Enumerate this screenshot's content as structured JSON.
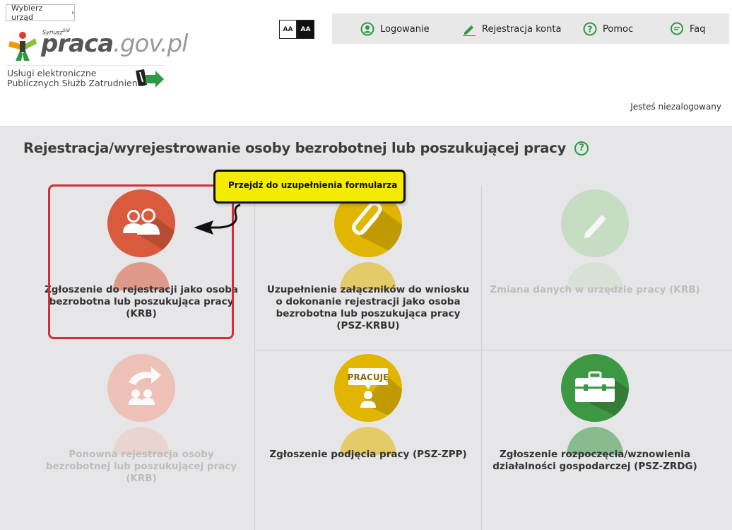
{
  "header": {
    "office_button": "Wybierz urząd",
    "logo": {
      "syriusz": "Syriusz",
      "syriusz_sup": "Std",
      "brand_main": "praca",
      "brand_suffix": ".gov.pl"
    },
    "services_line1": "Usługi elektroniczne",
    "services_line2": "Publicznych Służb Zatrudnienia",
    "font_size_small": "AA",
    "font_size_contrast": "AA",
    "nav": [
      {
        "label": "Logowanie",
        "icon": "user-circle-icon"
      },
      {
        "label": "Rejestracja konta",
        "icon": "pencil-icon"
      },
      {
        "label": "Pomoc",
        "icon": "question-circle-icon"
      },
      {
        "label": "Faq",
        "icon": "speech-bubble-icon"
      }
    ],
    "login_status": "Jesteś niezalogowany"
  },
  "main": {
    "title": "Rejestracja/wyrejestrowanie osoby bezrobotnej lub poszukującej pracy",
    "help_symbol": "?",
    "tooltip": "Przejdź do uzupełnienia formularza",
    "tiles": [
      {
        "label": "Zgłoszenie do rejestracji jako osoba bezrobotna lub poszukująca pracy (KRB)",
        "icon": "people-icon",
        "color": "#d95a3d",
        "enabled": true
      },
      {
        "label": "Uzupełnienie załączników do wniosku o dokonanie rejestracji jako osoba bezrobotna lub poszukująca pracy (PSZ-KRBU)",
        "icon": "paperclip-icon",
        "color": "#e1b500",
        "enabled": true
      },
      {
        "label": "Zmiana danych w urzędzie pracy (KRB)",
        "icon": "pencil-icon",
        "color": "#3d9843",
        "enabled": false
      },
      {
        "label": "Ponowna rejestracja osoby bezrobotnej lub poszukującej pracy (KRB)",
        "icon": "re-register-icon",
        "color": "#d95a3d",
        "enabled": false
      },
      {
        "label": "Zgłoszenie podjęcia pracy (PSZ-ZPP)",
        "icon": "job-sign-icon",
        "sign_text": "PRACUJĘ",
        "color": "#e1b500",
        "enabled": true
      },
      {
        "label": "Zgłoszenie rozpoczęcia/wznowienia działalności gospodarczej (PSZ-ZRDG)",
        "icon": "briefcase-icon",
        "color": "#3d9843",
        "enabled": true
      }
    ]
  },
  "colors": {
    "accent_green": "#2e9a45",
    "highlight_red": "#d52b3a",
    "tooltip_yellow": "#f5eb00"
  }
}
